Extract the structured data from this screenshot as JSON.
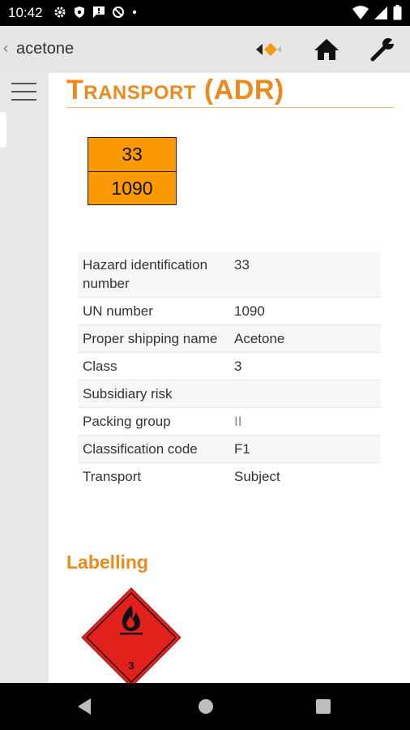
{
  "status": {
    "time": "10:42"
  },
  "appbar": {
    "back_title": "acetone",
    "icons": [
      "route-transport-icon",
      "home-icon",
      "wrench-icon"
    ]
  },
  "page": {
    "title": "Transport (ADR)",
    "plate": {
      "hazard_id": "33",
      "un_number": "1090"
    },
    "rows": [
      {
        "label": "Hazard identification number",
        "value": "33"
      },
      {
        "label": "UN number",
        "value": "1090"
      },
      {
        "label": "Proper shipping name",
        "value": "Acetone"
      },
      {
        "label": "Class",
        "value": "3"
      },
      {
        "label": "Subsidiary risk",
        "value": ""
      },
      {
        "label": "Packing group",
        "value": "II"
      },
      {
        "label": "Classification code",
        "value": "F1"
      },
      {
        "label": "Transport",
        "value": "Subject"
      }
    ],
    "labelling_title": "Labelling",
    "hazard_label": {
      "class": "3",
      "icon": "flame-icon",
      "color": "#e3211c"
    }
  },
  "colors": {
    "accent": "#ec8a1c",
    "plate": "#fb9a00"
  }
}
